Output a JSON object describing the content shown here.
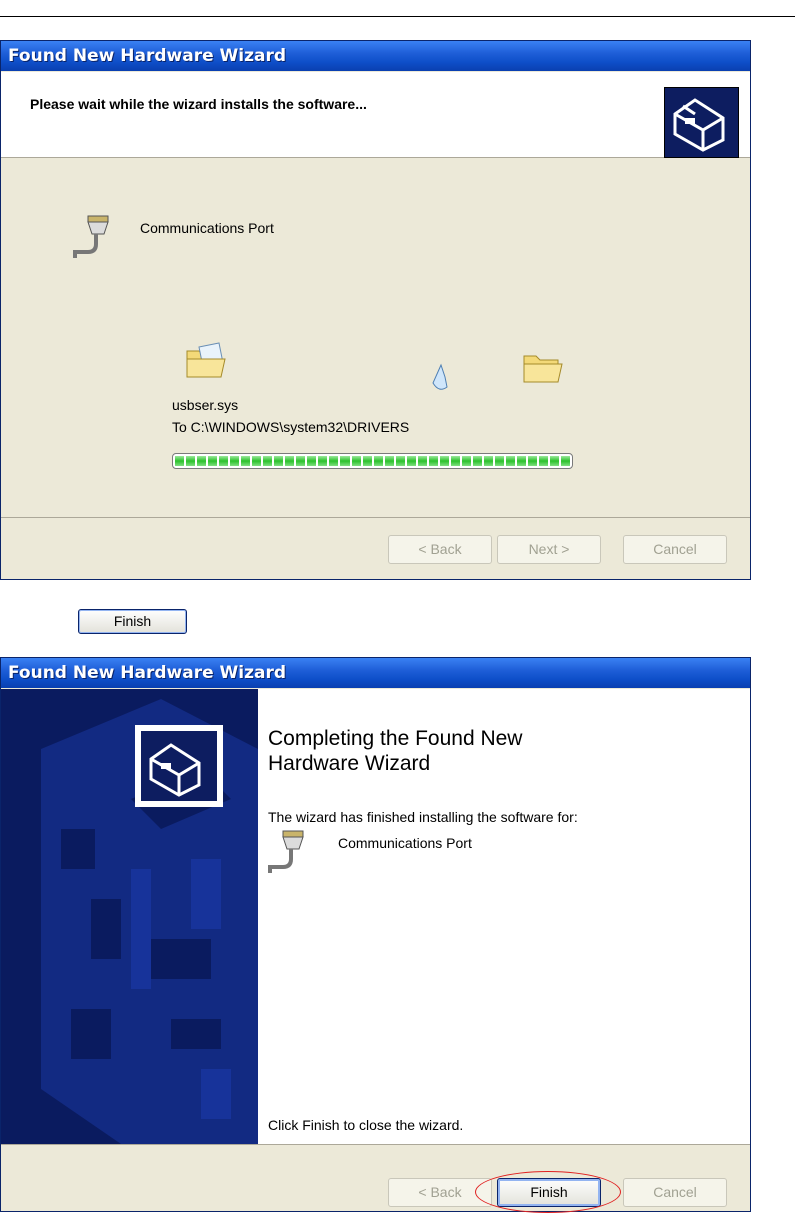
{
  "wizard1": {
    "title": "Found New Hardware Wizard",
    "header_text": "Please wait while the wizard installs the software...",
    "device_name": "Communications Port",
    "file_name": "usbser.sys",
    "destination": "To C:\\WINDOWS\\system32\\DRIVERS",
    "progress_fraction": 1.0,
    "buttons": {
      "back": "< Back",
      "next": "Next >",
      "cancel": "Cancel"
    }
  },
  "finish_button_label": "Finish",
  "wizard2": {
    "title": "Found New Hardware Wizard",
    "heading_line1": "Completing the Found New",
    "heading_line2": "Hardware Wizard",
    "message": "The wizard has finished installing the software for:",
    "device_name": "Communications Port",
    "close_hint": "Click Finish to close the wizard.",
    "buttons": {
      "back": "< Back",
      "finish": "Finish",
      "cancel": "Cancel"
    }
  },
  "colors": {
    "title_bar": "#0e4fc9",
    "face": "#ece9d8",
    "progress": "#2cc12c",
    "highlight_ellipse": "#e02020"
  }
}
